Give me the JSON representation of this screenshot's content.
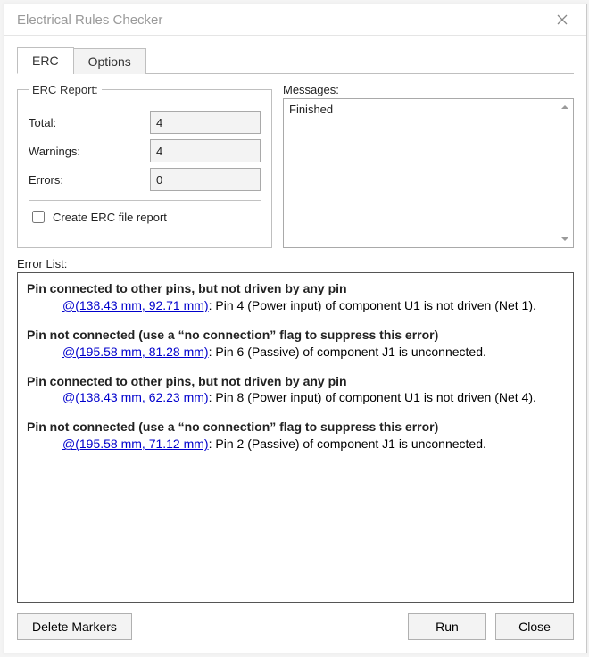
{
  "window": {
    "title": "Electrical Rules Checker"
  },
  "tabs": {
    "erc": "ERC",
    "options": "Options"
  },
  "erc_report": {
    "legend": "ERC Report:",
    "total_label": "Total:",
    "total_value": "4",
    "warnings_label": "Warnings:",
    "warnings_value": "4",
    "errors_label": "Errors:",
    "errors_value": "0",
    "create_file_label": "Create ERC file report"
  },
  "messages": {
    "label": "Messages:",
    "content": "Finished"
  },
  "error_list": {
    "label": "Error List:",
    "items": [
      {
        "title": "Pin connected to other pins, but not driven by any pin",
        "coord": "@(138.43 mm, 92.71 mm)",
        "msg": ": Pin 4 (Power input) of component U1 is not driven (Net 1)."
      },
      {
        "title": "Pin not connected (use a “no connection” flag to suppress this error)",
        "coord": "@(195.58 mm, 81.28 mm)",
        "msg": ": Pin 6 (Passive) of component J1 is unconnected."
      },
      {
        "title": "Pin connected to other pins, but not driven by any pin",
        "coord": "@(138.43 mm, 62.23 mm)",
        "msg": ": Pin 8 (Power input) of component U1 is not driven (Net 4)."
      },
      {
        "title": "Pin not connected (use a “no connection” flag to suppress this error)",
        "coord": "@(195.58 mm, 71.12 mm)",
        "msg": ": Pin 2 (Passive) of component J1 is unconnected."
      }
    ]
  },
  "buttons": {
    "delete_markers": "Delete Markers",
    "run": "Run",
    "close": "Close"
  }
}
